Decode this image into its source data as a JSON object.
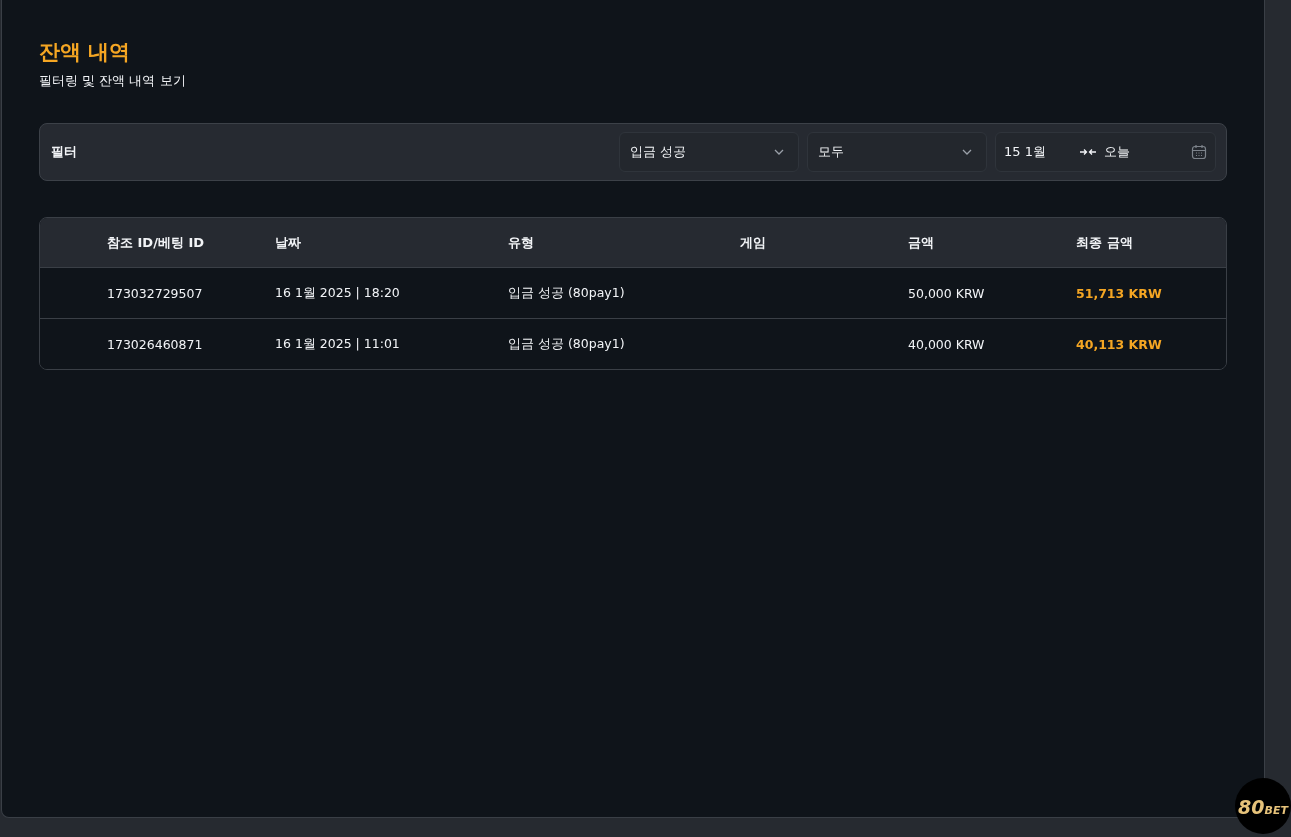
{
  "page": {
    "title": "잔액 내역",
    "subtitle": "필터링 및 잔액 내역 보기"
  },
  "filter": {
    "label": "필터",
    "status_select": {
      "value": "입금 성공"
    },
    "type_select": {
      "value": "모두"
    },
    "date_range": {
      "from": "15 1월",
      "to": "오늘"
    }
  },
  "table": {
    "columns": [
      "참조 ID/베팅 ID",
      "날짜",
      "유형",
      "게임",
      "금액",
      "최종 금액"
    ],
    "rows": [
      {
        "ref": "173032729507",
        "date": "16 1월 2025 | 18:20",
        "type": "입금 성공 (80pay1)",
        "amount": "50,000 KRW",
        "final": "51,713 KRW"
      },
      {
        "ref": "173026460871",
        "date": "16 1월 2025 | 11:01",
        "type": "입금 성공 (80pay1)",
        "amount": "40,000 KRW",
        "final": "40,113 KRW"
      }
    ]
  },
  "logo": {
    "number": "80",
    "word": "BET"
  }
}
